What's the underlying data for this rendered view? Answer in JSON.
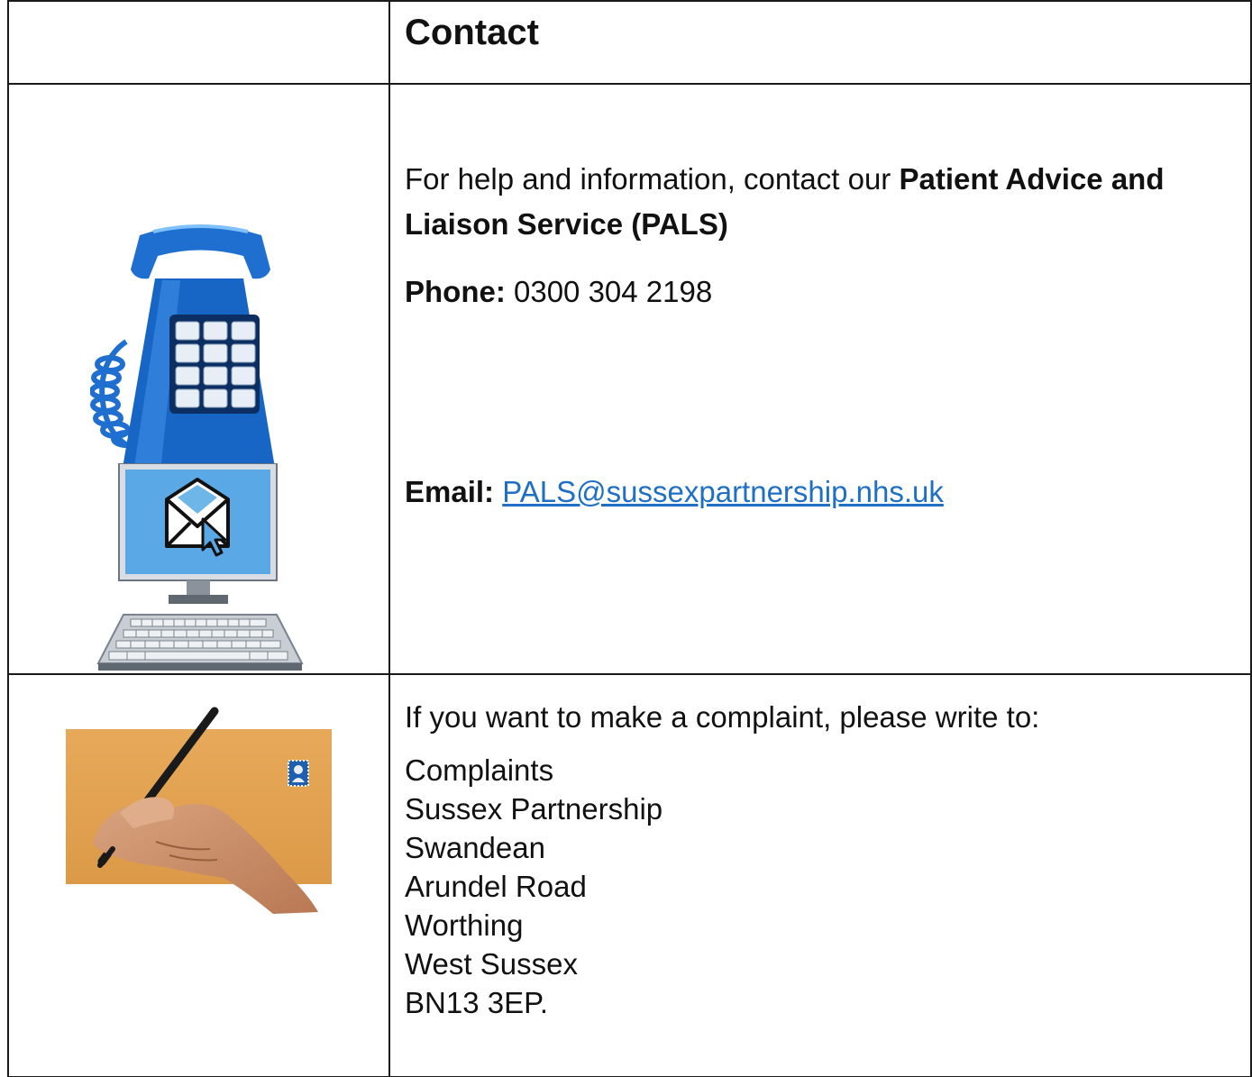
{
  "header": {
    "title": "Contact"
  },
  "pals": {
    "intro_text": "For help and information, contact our ",
    "service_name": "Patient Advice and Liaison Service (PALS)",
    "phone_label": "Phone:",
    "phone_number": "0300 304 2198",
    "email_label": "Email:",
    "email_address": "PALS@sussexpartnership.nhs.uk"
  },
  "complaints": {
    "intro": "If you want to make a complaint, please write to:",
    "address_lines": [
      "Complaints",
      "Sussex Partnership",
      "Swandean",
      "Arundel Road",
      "Worthing",
      "West Sussex",
      "BN13 3EP."
    ]
  },
  "icons": {
    "phone": "telephone-icon",
    "computer": "computer-email-icon",
    "letter": "hand-writing-letter-icon"
  },
  "colors": {
    "link": "#1f6fc5",
    "phone_blue": "#1e6fd0",
    "screen_blue": "#5aa9e6",
    "envelope_tan": "#e7a95a"
  }
}
